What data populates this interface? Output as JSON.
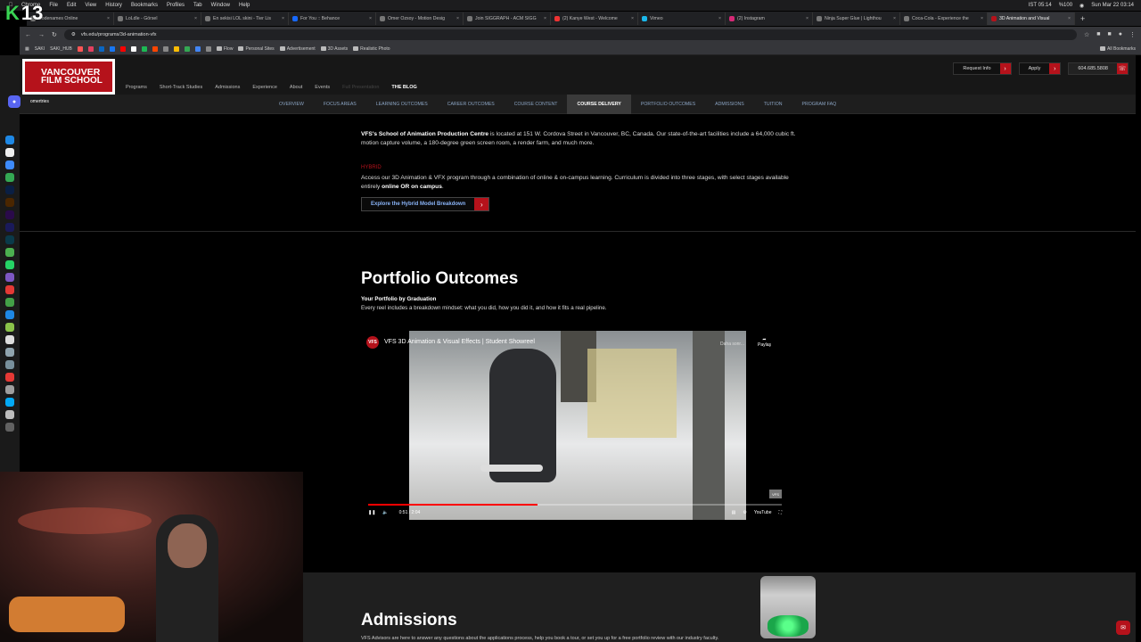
{
  "menubar": {
    "app": "Chrome",
    "items": [
      "File",
      "Edit",
      "View",
      "History",
      "Bookmarks",
      "Profiles",
      "Tab",
      "Window",
      "Help"
    ],
    "status": [
      "IST 05:14",
      "%100",
      "Sun Mar 22  03:14"
    ]
  },
  "timer": {
    "k": "K",
    "value": "13"
  },
  "tabs": [
    "Codenames Online",
    "LoLdle - Görsel",
    "En sekisi LOL skini - Tier Lis",
    "For You :: Behance",
    "Omer Ozsoy - Motion Desig",
    "Join SIGGRAPH - ACM SIGG",
    "(2) Kanye West - Welcome",
    "Vimeo",
    "(2) Instagram",
    "Ninja Super Glue | Lighthou",
    "Coca-Cola - Experience the",
    "3D Animation and Visual"
  ],
  "address": {
    "url": "vfs.edu/programs/3d-animation-vfx"
  },
  "bookmarks": {
    "left": [
      "SAKI",
      "SAKI_HUB"
    ],
    "folders": [
      "Flow",
      "Personal Sites",
      "Advertisement",
      "3D Assets",
      "Realistic Photo"
    ],
    "all": "All Bookmarks"
  },
  "profile": {
    "name": "omertries"
  },
  "site": {
    "logo": {
      "line1": "VANCOUVER",
      "line2": "FILM SCHOOL"
    },
    "nav": [
      "Programs",
      "Short-Track Studies",
      "Admissions",
      "Experience",
      "About",
      "Events"
    ],
    "nav_dim": "Full Presentation",
    "nav_blog": "THE BLOG",
    "ctas": {
      "request": "Request Info",
      "apply": "Apply",
      "phone": "604.685.5808"
    },
    "subnav": [
      "OVERVIEW",
      "FOCUS AREAS",
      "LEARNING OUTCOMES",
      "CAREER OUTCOMES",
      "COURSE CONTENT",
      "COURSE DELIVERY",
      "PORTFOLIO OUTCOMES",
      "ADMISSIONS",
      "TUITION",
      "PROGRAM FAQ"
    ],
    "subnav_active_index": 5
  },
  "content": {
    "p1_bold": "VFS's School of Animation Production Centre",
    "p1_rest": " is located at 151 W. Cordova Street in Vancouver, BC, Canada. Our state-of-the-art facilities include a 64,000 cubic ft. motion capture volume, a 180-degree green screen room, a render farm, and much more.",
    "red_label": "HYBRID",
    "p2_start": "Access our 3D Animation & VFX program through a combination of online & on-campus learning. Curriculum is divided into three stages, with select stages available entirely ",
    "p2_bold": "online OR on campus",
    "p2_end": ".",
    "hybrid_button": "Explore the Hybrid Model Breakdown"
  },
  "portfolio": {
    "title": "Portfolio Outcomes",
    "subtitle": "Your Portfolio by Graduation",
    "desc": "Every reel includes a breakdown mindset: what you did, how you did it, and how it fits a real pipeline."
  },
  "video": {
    "channel": "VFS",
    "title": "VFS 3D Animation & Visual Effects | Student Showreel",
    "later": "Daha sonr...",
    "share": "Paylaş",
    "time": "0:51 / 2:04",
    "progress": 0.41,
    "logo_mark": "VFS",
    "yt": "YouTube"
  },
  "admissions": {
    "title": "Admissions",
    "desc": "VFS Advisors are here to answer any questions about the applications process, help you book a tour, or set you up for a free portfolio review with our industry faculty."
  },
  "colors": {
    "brand_red": "#b5121b",
    "link_blue": "#8ab4f8",
    "subnav_text": "#8aa3c2"
  }
}
